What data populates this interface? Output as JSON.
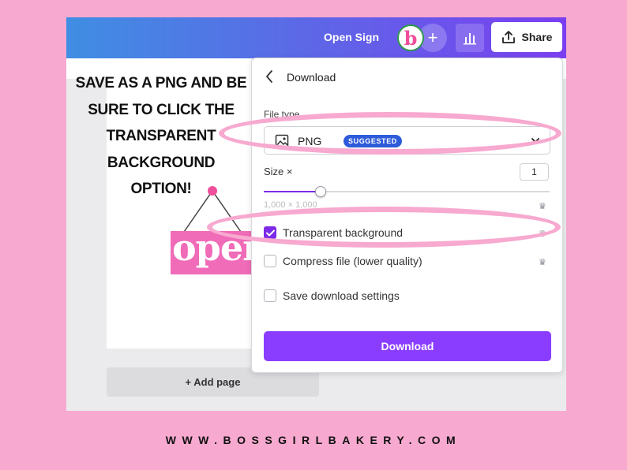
{
  "header": {
    "doc_title": "Open Sign",
    "avatar_letter": "b",
    "plus_symbol": "+",
    "share_label": "Share"
  },
  "canvas": {
    "sign_text": "open",
    "add_page_label": "+ Add page"
  },
  "instruction": {
    "lines": [
      "SAVE AS A PNG AND BE",
      "SURE TO CLICK THE",
      "TRANSPARENT",
      "BACKGROUND",
      "OPTION!"
    ]
  },
  "download_panel": {
    "title": "Download",
    "file_type_label": "File type",
    "file_type_value": "PNG",
    "file_type_badge": "SUGGESTED",
    "size_label": "Size ×",
    "size_value": "1",
    "size_slider_fraction": 0.2,
    "dimensions_text": "1,000 × 1,000",
    "options": [
      {
        "label": "Transparent background",
        "checked": true
      },
      {
        "label": "Compress file (lower quality)",
        "checked": false
      },
      {
        "label": "Save download settings",
        "checked": false
      }
    ],
    "download_button_label": "Download"
  },
  "footer": {
    "url": "WWW.BOSSGIRLBAKERY.COM"
  },
  "colors": {
    "background_pink": "#f7a9cf",
    "accent_purple": "#8b3dff",
    "badge_blue": "#2e5bd9",
    "sign_pink": "#f06bb8"
  }
}
